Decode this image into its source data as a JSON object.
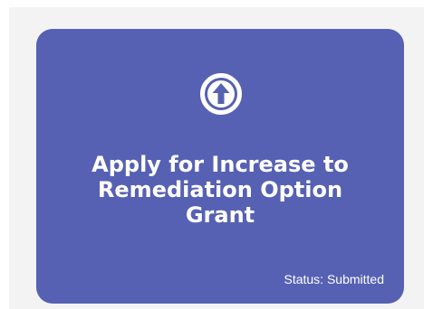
{
  "card": {
    "title_lines": [
      "Apply for Increase to",
      "Remediation Option",
      "Grant"
    ],
    "status_text": "Status: Submitted",
    "icon": "arrow-up-circle-icon",
    "color": "#5661b3"
  }
}
